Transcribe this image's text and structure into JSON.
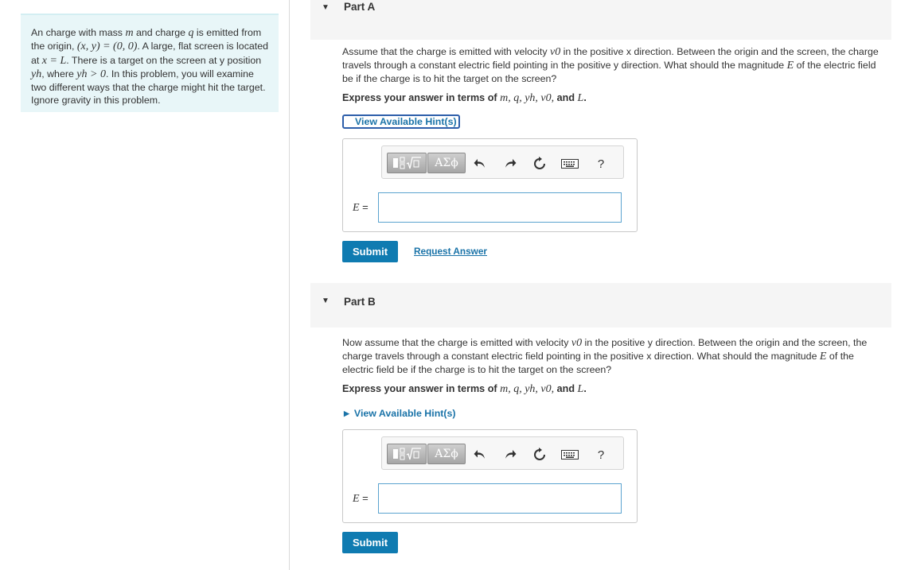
{
  "intro": {
    "t1": "An charge with mass ",
    "m": "m",
    "t2": " and charge ",
    "q": "q",
    "t3": " is emitted from the origin, ",
    "origin": "(x, y) = (0, 0)",
    "t4": ". A large, flat screen is located at ",
    "xeq": "x = L",
    "t5": ". There is a target on the screen at y position ",
    "yh": "yh",
    "t6": ", where ",
    "yhcond": "yh > 0",
    "t7": ". In this problem, you will examine two different ways that the charge might hit the target. Ignore gravity in this problem."
  },
  "partA": {
    "label": "Part A",
    "q1": "Assume that the charge is emitted with velocity ",
    "v0": "v0",
    "q2": " in the positive x direction. Between the origin and the screen, the charge travels through a constant electric field pointing in the positive y direction. What should the magnitude ",
    "E": "E",
    "q3": " of the electric field be if the charge is to hit the target on the screen?",
    "express_prefix": "Express your answer in terms of ",
    "express_vars": "m, q, yh, v0,",
    "express_and": " and ",
    "express_L": "L",
    "express_end": ".",
    "hint": "View Available Hint(s)",
    "greek": "ΑΣϕ",
    "help": "?",
    "eq_var": "E",
    "eq_sign": " =",
    "submit": "Submit",
    "request": "Request Answer"
  },
  "partB": {
    "label": "Part B",
    "q1": "Now assume that the charge is emitted with velocity ",
    "v0": "v0",
    "q2": " in the positive y direction. Between the origin and the screen, the charge travels through a constant electric field pointing in the positive x direction. What should the magnitude ",
    "E": "E",
    "q3": " of the electric field be if the charge is to hit the target on the screen?",
    "express_prefix": "Express your answer in terms of ",
    "express_vars": "m, q, yh, v0,",
    "express_and": " and ",
    "express_L": "L",
    "express_end": ".",
    "hint": "View Available Hint(s)",
    "greek": "ΑΣϕ",
    "help": "?",
    "eq_var": "E",
    "eq_sign": " =",
    "submit": "Submit"
  },
  "icons": {
    "collapse": "caret-down-icon",
    "hint": "caret-right-icon",
    "template": "fraction-sqrt-template-icon",
    "undo": "undo-icon",
    "redo": "redo-icon",
    "reset": "reset-icon",
    "keyboard": "keyboard-icon",
    "help": "help-icon"
  },
  "colors": {
    "intro_bg": "#e8f6f8",
    "submit_bg": "#0f7bb1",
    "link": "#1a73a8",
    "input_border": "#5aa3cf"
  }
}
